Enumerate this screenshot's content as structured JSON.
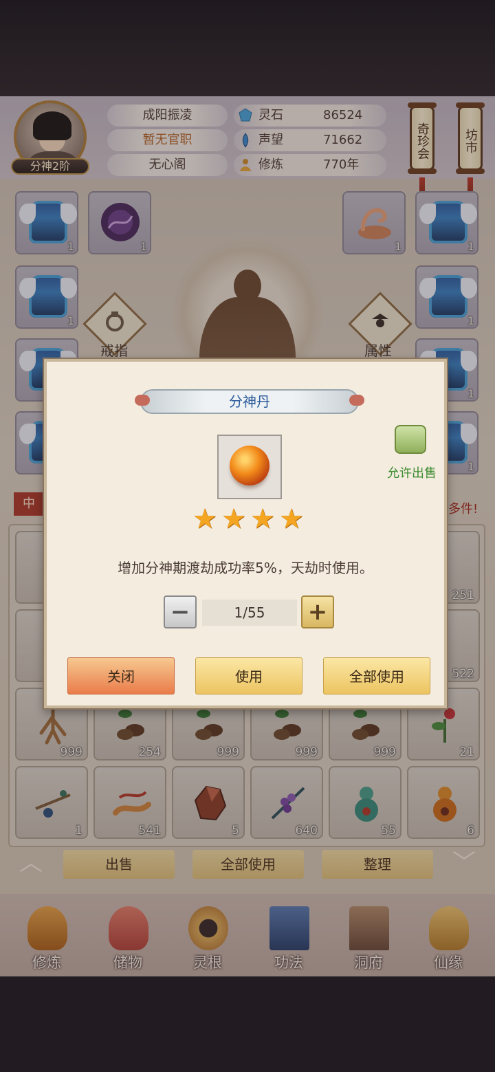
{
  "header": {
    "rank_badge": "分神2阶",
    "name": "成阳振凌",
    "official_post": "暂无官职",
    "sect": "无心阁",
    "resources": [
      {
        "icon": "spirit-stone-icon",
        "label": "灵石",
        "value": "86524"
      },
      {
        "icon": "reputation-icon",
        "label": "声望",
        "value": "71662"
      },
      {
        "icon": "cultivation-icon",
        "label": "修炼",
        "value": "770年"
      }
    ],
    "shops": [
      {
        "label": "奇珍会"
      },
      {
        "label": "坊市"
      }
    ]
  },
  "equipment": {
    "left_slots": [
      "1",
      "1",
      "1"
    ],
    "top_left_second_count": "1",
    "right_top_counts": [
      "1",
      "1"
    ],
    "right_slots": [
      "1",
      "1",
      "1"
    ],
    "ring_label": "戒指",
    "attr_label": "属性"
  },
  "notice": {
    "tag": "中",
    "text": "多件!"
  },
  "inventory": {
    "rows": [
      [
        "",
        "",
        "",
        "",
        "",
        "251"
      ],
      [
        "",
        "",
        "",
        "",
        "",
        "522"
      ],
      [
        "999",
        "254",
        "999",
        "999",
        "999",
        "21"
      ],
      [
        "1",
        "541",
        "5",
        "640",
        "55",
        "6"
      ]
    ]
  },
  "actions": {
    "sell": "出售",
    "use_all": "全部使用",
    "organize": "整理"
  },
  "nav": [
    {
      "label": "修炼",
      "icon": "cultivate-icon"
    },
    {
      "label": "储物",
      "icon": "storage-bag-icon"
    },
    {
      "label": "灵根",
      "icon": "spirit-root-icon"
    },
    {
      "label": "功法",
      "icon": "technique-book-icon"
    },
    {
      "label": "洞府",
      "icon": "cave-abode-icon"
    },
    {
      "label": "仙缘",
      "icon": "immortal-fate-icon"
    }
  ],
  "modal": {
    "title": "分神丹",
    "allow_sell": "允许出售",
    "stars": 4,
    "description": "增加分神期渡劫成功率5%，天劫时使用。",
    "quantity": "1/55",
    "minus": "−",
    "plus": "+",
    "buttons": {
      "close": "关闭",
      "use": "使用",
      "use_all": "全部使用"
    }
  },
  "colors": {
    "accent_gold": "#ecc461",
    "close_orange": "#e97c4a",
    "title_blue": "#2a5a9a",
    "allow_green": "#3e8c2f",
    "star": "#f4a623"
  }
}
